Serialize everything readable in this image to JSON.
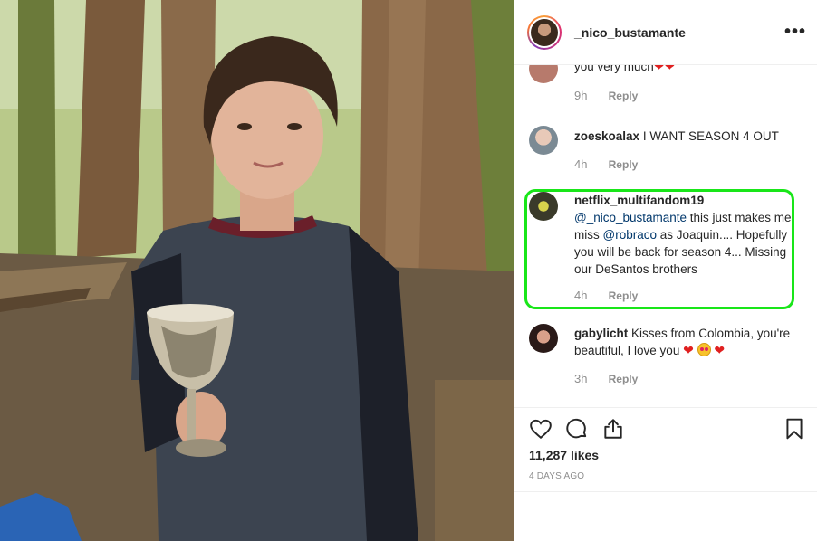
{
  "post": {
    "username": "_nico_bustamante",
    "more_label": "•••",
    "likes": "11,287 likes",
    "date": "4 DAYS AGO"
  },
  "comments": [
    {
      "user": "",
      "text": "you very much",
      "emojis": [
        "heart",
        "heart"
      ],
      "time": "9h",
      "reply": "Reply"
    },
    {
      "user": "zoeskoalax",
      "text": "I WANT SEASON 4 OUT",
      "time": "4h",
      "reply": "Reply"
    },
    {
      "user": "netflix_multifandom19",
      "mention1": "@_nico_bustamante",
      "text1": " this just makes me miss ",
      "mention2": "@robraco",
      "text2": " as Joaquin.... Hopefully you will be back for season 4... Missing our DeSantos brothers",
      "time": "4h",
      "reply": "Reply",
      "highlighted": true,
      "highlight_color": "#19e619"
    },
    {
      "user": "gabylicht",
      "text": "Kisses from Colombia, you're beautiful, I love you",
      "emojis": [
        "heart",
        "heart-eyes",
        "heart"
      ],
      "time": "3h",
      "reply": "Reply"
    }
  ],
  "icons": {
    "like": "heart-outline-icon",
    "comment": "comment-bubble-icon",
    "share": "share-icon",
    "save": "bookmark-icon",
    "more": "more-options-icon"
  },
  "colors": {
    "text": "#262626",
    "secondary": "#8e8e8e",
    "mention": "#00376b",
    "highlight": "#19e619",
    "heart": "#e02020"
  }
}
